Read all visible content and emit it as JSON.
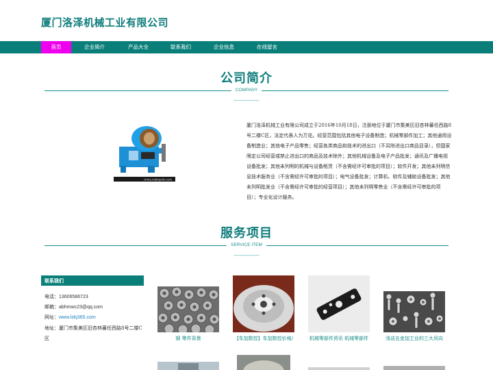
{
  "header": {
    "title": "厦门洛泽机械工业有限公司"
  },
  "nav": {
    "items": [
      {
        "label": "首页",
        "active": true
      },
      {
        "label": "企业简介",
        "active": false
      },
      {
        "label": "产品大全",
        "active": false
      },
      {
        "label": "联系我们",
        "active": false
      },
      {
        "label": "企业信息",
        "active": false
      },
      {
        "label": "在线留言",
        "active": false
      }
    ]
  },
  "about": {
    "title": "公司简介",
    "subtitle": "COMPANY",
    "dash": "----------------",
    "image_watermark": "china.makepolo.com",
    "text": "厦门洛泽机械工业有限公司成立于2016年10月18日，注册地位于厦门市集美区旧杏林蕃任西路8号二楼C区，法定代表人为万花。经营范围包括其他电子设备制造；机械零部件加工；其他通用设备制造业；其他电子产品零售；经营各类商品和技术的进出口（不另附进出口商品目录），但国家限定公司经营或禁止进出口的商品及技术除外；其他机械设备及电子产品批发；通讯及广播电视设备批发；其他未列明的机械与设备租赁（不含需经许可审批的项目）；软件开发；其他未列明信息技术服务业（不含需经许可审批的项目）；电气设备批发；计算机、软件及辅助设备批发；其他未列明批发业（不含需经许可审批的经营项目）；其他未列明零售业（不含需经许可审批的项目）；专业化设计服务。"
  },
  "services": {
    "title": "服务项目",
    "subtitle": "SERVICE ITEM",
    "dash": "----------------"
  },
  "contact": {
    "heading": "联系我们",
    "phone_label": "电话：",
    "phone": "13606586723",
    "email_label": "邮箱：",
    "email": "abhmwc23@qq.com",
    "site_label": "网址：",
    "site": "www.lzkj365.com",
    "address_label": "地址：",
    "address": "厦门市集美区旧杏林蕃任西路8号二楼C区"
  },
  "products": [
    {
      "caption": "钢 零件背景"
    },
    {
      "caption": "【车加数控】车加数控价格/"
    },
    {
      "caption": "机械零部件资讯 机械零部件"
    },
    {
      "caption": "浅谈五金加工业的三大风向"
    }
  ],
  "colors": {
    "brand": "#0a7f7a",
    "active_nav": "#ee00ee",
    "link": "#1a7fbf"
  }
}
